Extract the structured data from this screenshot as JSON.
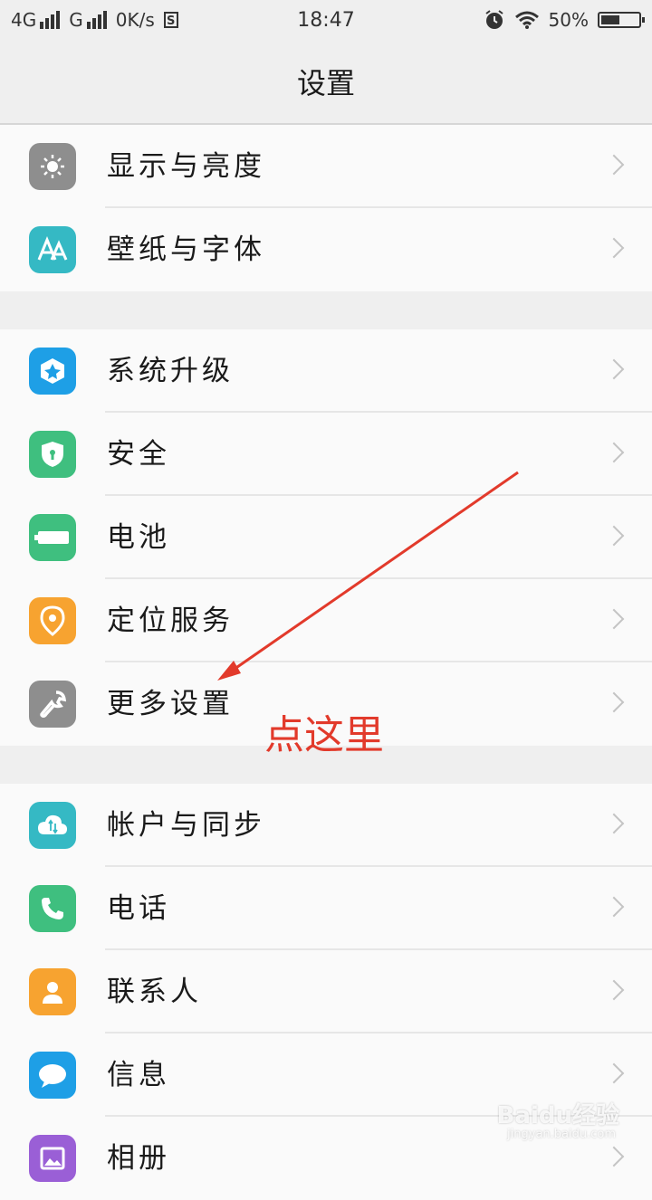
{
  "status_bar": {
    "network_4g": "4G",
    "network_g": "G",
    "speed": "0K/s",
    "s_badge": "S",
    "time": "18:47",
    "battery_percent": "50%",
    "battery_level": 0.5
  },
  "header": {
    "title": "设置"
  },
  "groups": [
    [
      {
        "label": "显示与亮度",
        "icon": "brightness-icon",
        "color": "#8e8e8e"
      },
      {
        "label": "壁纸与字体",
        "icon": "font-icon",
        "color": "#35b9c4"
      }
    ],
    [
      {
        "label": "系统升级",
        "icon": "system-update-icon",
        "color": "#1e9fe6"
      },
      {
        "label": "安全",
        "icon": "shield-icon",
        "color": "#3fbf7f"
      },
      {
        "label": "电池",
        "icon": "battery-icon",
        "color": "#3fbf7f"
      },
      {
        "label": "定位服务",
        "icon": "location-icon",
        "color": "#f7a330"
      },
      {
        "label": "更多设置",
        "icon": "wrench-icon",
        "color": "#8e8e8e"
      }
    ],
    [
      {
        "label": "帐户与同步",
        "icon": "cloud-sync-icon",
        "color": "#35b9c4"
      },
      {
        "label": "电话",
        "icon": "phone-icon",
        "color": "#3fbf7f"
      },
      {
        "label": "联系人",
        "icon": "contact-icon",
        "color": "#f7a330"
      },
      {
        "label": "信息",
        "icon": "message-icon",
        "color": "#1e9fe6"
      },
      {
        "label": "相册",
        "icon": "album-icon",
        "color": "#9a5fd6"
      }
    ]
  ],
  "annotation": {
    "text": "点这里",
    "color": "#e23a2b"
  },
  "watermark": {
    "text": "Baidu经验",
    "sub": "jingyan.baidu.com"
  }
}
